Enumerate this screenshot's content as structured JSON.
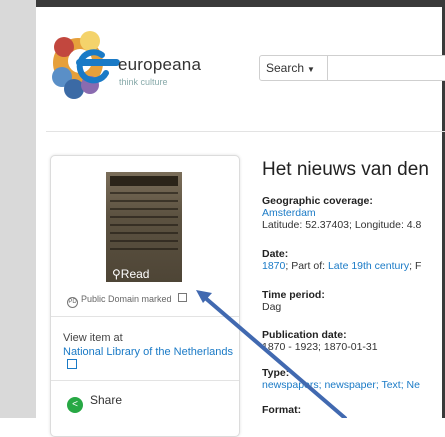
{
  "brand": {
    "name": "europeana",
    "tagline": "think culture"
  },
  "search": {
    "select_label": "Search"
  },
  "card": {
    "read_label": "Read",
    "rights_label": "Public Domain marked",
    "view_item_at": "View item at",
    "provider_link": "National Library of the Netherlands",
    "share_label": "Share"
  },
  "record": {
    "title": "Het nieuws van den",
    "fields": [
      {
        "label": "Geographic coverage:",
        "link": "Amsterdam",
        "text": "Latitude: 52.37403; Longitude: 4.8"
      },
      {
        "label": "Date:",
        "link": "1870",
        "text": "; Part of: ",
        "link2": "Late 19th century",
        "text2": "; F"
      },
      {
        "label": "Time period:",
        "text": "Dag"
      },
      {
        "label": "Publication date:",
        "text": "1870 - 1923; 1870-01-31"
      },
      {
        "label": "Type:",
        "link": "newspapers; newspaper; Text; Ne"
      },
      {
        "label": "Format:"
      }
    ]
  },
  "colors": {
    "link": "#1a7ac6",
    "share": "#27a844",
    "annotation_arrow": "#4169b0"
  }
}
